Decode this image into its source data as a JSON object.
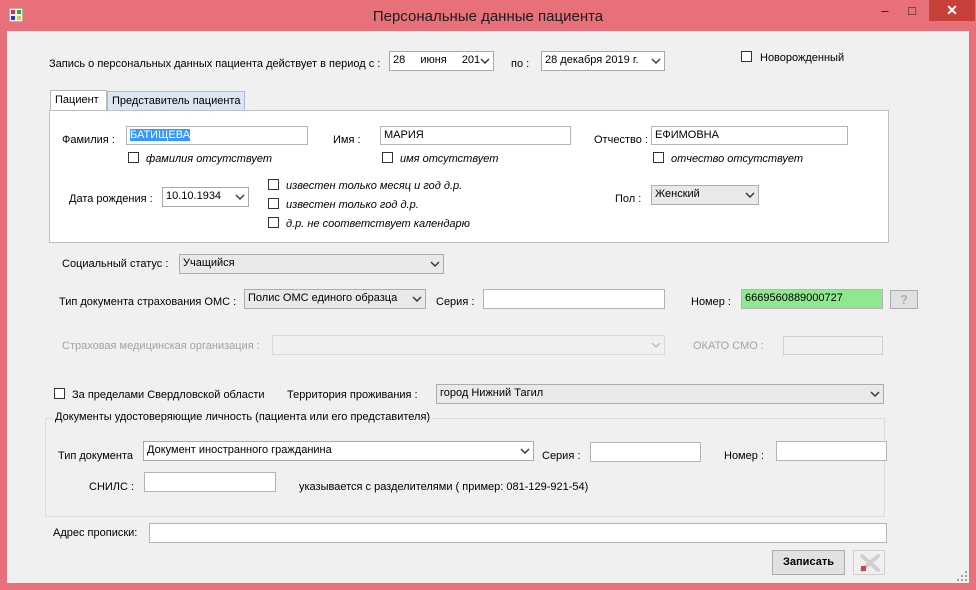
{
  "window": {
    "title": "Персональные данные пациента",
    "minimize": "–",
    "maximize": "□",
    "close": "✕"
  },
  "period": {
    "label": "Запись о персональных данных пациента  действует в период с :",
    "from_day": "28",
    "from_month": "июня",
    "from_year": "201",
    "to_label": "по :",
    "to_value": "28 декабря  2019 г."
  },
  "newborn": {
    "label": "Новорожденный",
    "checked": false
  },
  "tabs": [
    {
      "label": "Пациент",
      "active": true
    },
    {
      "label": "Представитель пациента",
      "active": false
    }
  ],
  "patient": {
    "surname_label": "Фамилия :",
    "surname_value": "БАТИЩЕВА",
    "surname_missing_label": "фамилия отсутствует",
    "name_label": "Имя :",
    "name_value": "МАРИЯ",
    "name_missing_label": "имя отсутствует",
    "patronymic_label": "Отчество :",
    "patronymic_value": "ЕФИМОВНА",
    "patronymic_missing_label": "отчество отсутствует",
    "birthdate_label": "Дата рождения :",
    "birthdate_value": "10.10.1934",
    "only_month_year_label": "известен только месяц и год д.р.",
    "only_year_label": "известен только  год д.р.",
    "not_calendar_label": "д.р. не соответствует календарю",
    "gender_label": "Пол :",
    "gender_value": "Женский"
  },
  "social": {
    "label": "Социальный статус :",
    "value": "Учащийся"
  },
  "oms": {
    "doc_type_label": "Тип документа страхования ОМС :",
    "doc_type_value": "Полис ОМС единого образца",
    "series_label": "Серия :",
    "series_value": "",
    "number_label": "Номер :",
    "number_value": "6669560889000727",
    "help_label": "?",
    "insurer_label": "Страховая медицинская организация :",
    "insurer_value": "",
    "okato_label": "ОКАТО СМО :",
    "okato_value": ""
  },
  "residence": {
    "outside_label": "За пределами Свердловской области",
    "outside_checked": false,
    "territory_label": "Территория проживания :",
    "territory_value": "город Нижний Тагил"
  },
  "id_docs": {
    "group_label": "Документы удостоверяющие личность (пациента или его представителя)",
    "type_label": "Тип документа",
    "type_value": "Документ иностранного гражданина",
    "series_label": "Серия :",
    "series_value": "",
    "number_label": "Номер :",
    "number_value": "",
    "snils_label": "СНИЛС :",
    "snils_value": "",
    "snils_hint": "указывается с разделителями ( пример: 081-129-921-54)"
  },
  "address": {
    "label": "Адрес прописки:",
    "value": ""
  },
  "actions": {
    "save_label": "Записать"
  },
  "colors": {
    "frame": "#e8707a",
    "close_button": "#c7413a",
    "highlight": "#3399ff",
    "number_field": "#8fe88f"
  }
}
